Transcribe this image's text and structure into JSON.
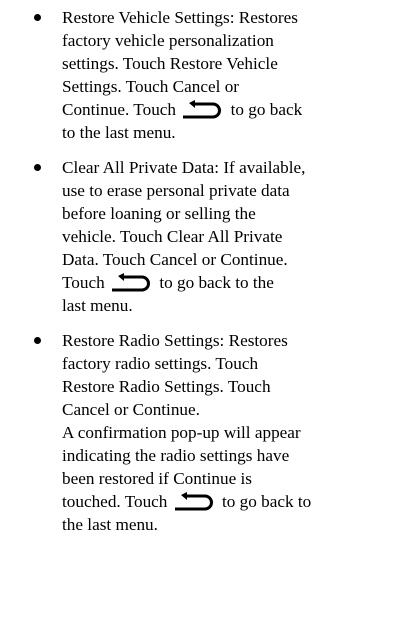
{
  "items": [
    {
      "lines": [
        "Restore Vehicle Settings: Restores",
        "factory vehicle personalization",
        "settings. Touch Restore Vehicle",
        "Settings. Touch Cancel or"
      ],
      "icon_line_before": "Continue. Touch ",
      "icon_line_after": " to go back",
      "tail_lines": [
        "to the last menu."
      ]
    },
    {
      "lines": [
        "Clear All Private Data: If available,",
        "use to erase personal private data",
        "before loaning or selling the",
        "vehicle. Touch Clear All Private",
        "Data. Touch Cancel or Continue."
      ],
      "icon_line_before": "Touch ",
      "icon_line_after": " to go back to the",
      "tail_lines": [
        "last menu."
      ]
    },
    {
      "lines": [
        "Restore Radio Settings: Restores",
        "factory radio settings. Touch",
        "Restore Radio Settings. Touch",
        "Cancel or Continue.",
        "A confirmation pop-up will appear",
        "indicating the radio settings have",
        "been restored if Continue is"
      ],
      "icon_line_before": "touched. Touch ",
      "icon_line_after": " to go back to",
      "tail_lines": [
        "the last menu."
      ]
    }
  ],
  "icon": "back-arrow-icon"
}
